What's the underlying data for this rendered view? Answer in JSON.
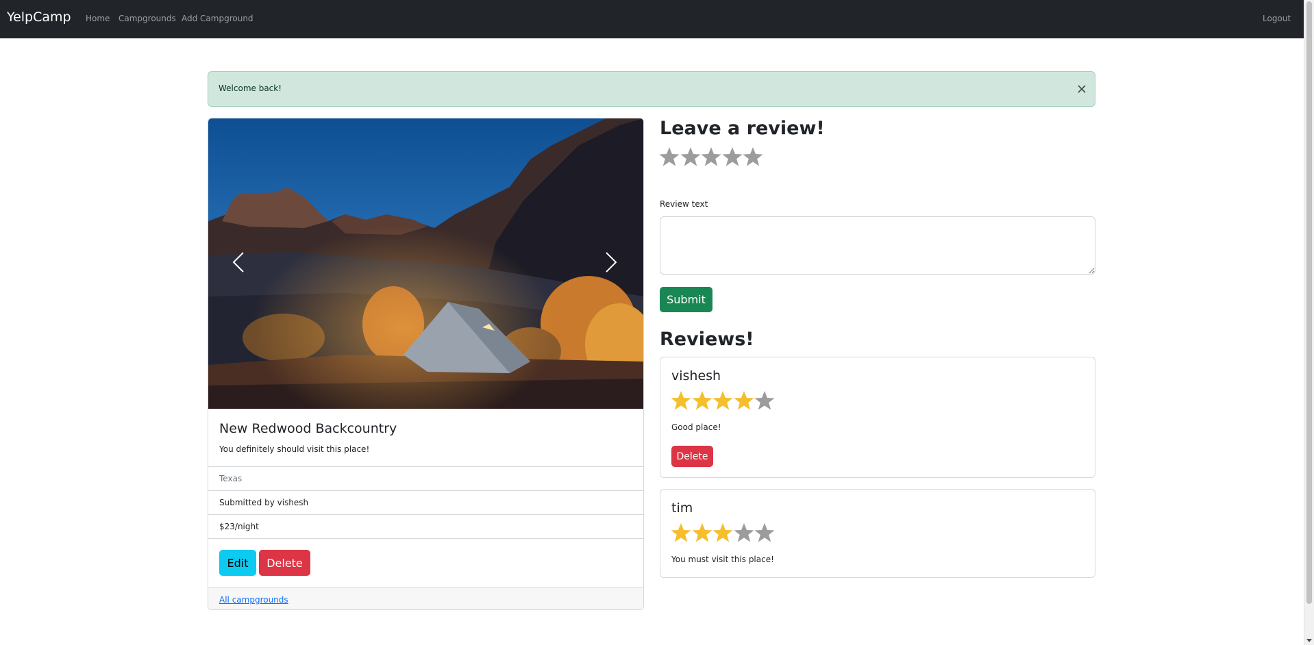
{
  "navbar": {
    "brand": "YelpCamp",
    "links": [
      "Home",
      "Campgrounds",
      "Add Campground"
    ],
    "logout": "Logout",
    "background": "#212529"
  },
  "alert": {
    "message": "Welcome back!",
    "background": "#d1e7dd",
    "close_icon": "close-icon"
  },
  "campground": {
    "image_alt": "tent-in-canyon-photo",
    "title": "New Redwood Backcountry",
    "description": "You definitely should visit this place!",
    "location": "Texas",
    "author": "Submitted by vishesh",
    "price": "$23/night",
    "edit_label": "Edit",
    "delete_label": "Delete",
    "footer_link": "All campgrounds",
    "prev_icon": "chevron-left-icon",
    "next_icon": "chevron-right-icon"
  },
  "review_form": {
    "heading": "Leave a review!",
    "rating_selected": 0,
    "rating_max": 5,
    "text_label": "Review text",
    "text_value": "",
    "submit_label": "Submit"
  },
  "reviews": {
    "heading": "Reviews!",
    "items": [
      {
        "author": "vishesh",
        "rating": 4,
        "max": 5,
        "text": "Good place!",
        "delete_label": "Delete"
      },
      {
        "author": "tim",
        "rating": 3,
        "max": 5,
        "text": "You must visit this place!"
      }
    ]
  },
  "colors": {
    "star_filled": "#f5be2c",
    "star_empty": "#9c9c9c",
    "edit_button": "#0dcaf0",
    "delete_button": "#dc3545",
    "submit_button": "#198754"
  }
}
